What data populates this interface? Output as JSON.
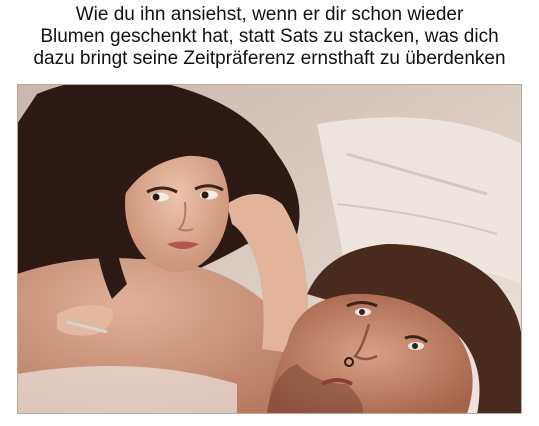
{
  "caption": {
    "lines": [
      "Wie du ihn ansiehst, wenn er dir schon wieder",
      "Blumen geschenkt hat, statt Sats zu stacken, was dich",
      "dazu bringt seine Zeitpräferenz ernsthaft zu überdenken"
    ]
  },
  "photo": {
    "subjects": [
      "woman-looking-sideways",
      "man-lying-in-bed"
    ],
    "colors": {
      "sheet": "#e9e1dc",
      "wall": "#d9cdc4",
      "skin_light": "#e3b8a0",
      "skin_mid": "#c98b6e",
      "skin_dark": "#8f5440",
      "hair_dark": "#2a1813",
      "hair_man": "#4a2a1c"
    }
  }
}
